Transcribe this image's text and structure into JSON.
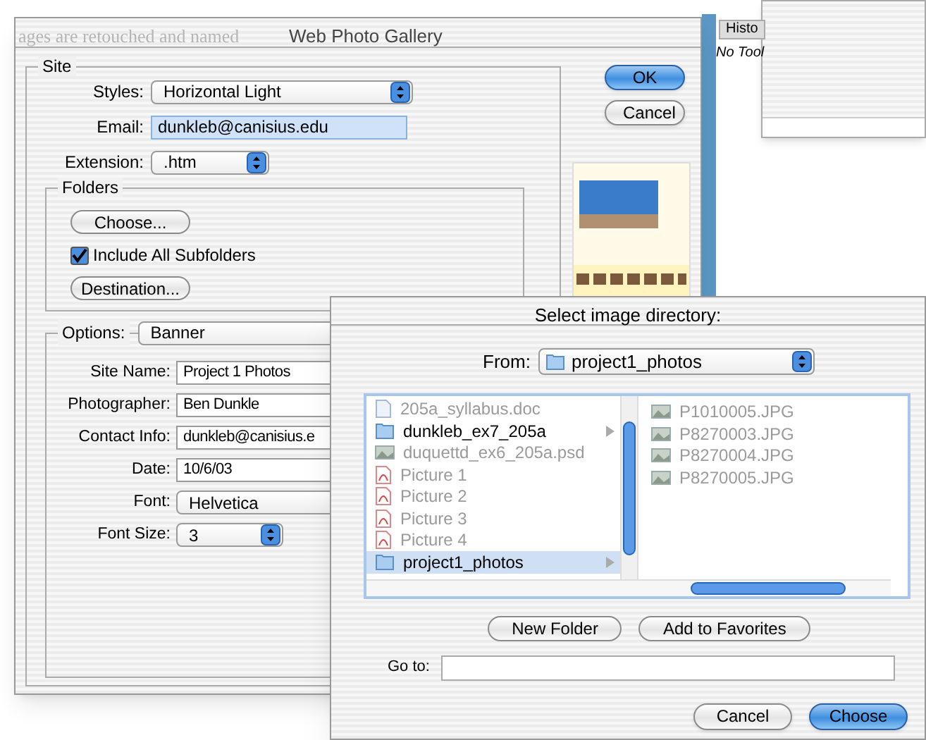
{
  "background": {
    "document_text": "ages are retouched and named",
    "history_tab": "Histo",
    "tool_text": "No Tool"
  },
  "dialog": {
    "title": "Web Photo Gallery",
    "site": {
      "legend": "Site",
      "styles": {
        "label": "Styles:",
        "value": "Horizontal Light"
      },
      "email": {
        "label": "Email:",
        "value": "dunkleb@canisius.edu",
        "focused": true
      },
      "extension": {
        "label": "Extension:",
        "value": ".htm"
      },
      "folders": {
        "legend": "Folders",
        "choose": "Choose...",
        "include_subfolders": {
          "label": "Include All Subfolders",
          "checked": true
        },
        "destination": "Destination..."
      },
      "options": {
        "label": "Options:",
        "value": "Banner",
        "fields": [
          {
            "kind": "text",
            "label": "Site Name:",
            "value": "Project 1 Photos"
          },
          {
            "kind": "text",
            "label": "Photographer:",
            "value": "Ben Dunkle"
          },
          {
            "kind": "text",
            "label": "Contact Info:",
            "value": "dunkleb@canisius.e"
          },
          {
            "kind": "text",
            "label": "Date:",
            "value": "10/6/03"
          },
          {
            "kind": "popup",
            "label": "Font:",
            "value": "Helvetica"
          },
          {
            "kind": "popup",
            "label": "Font Size:",
            "value": "3"
          }
        ]
      }
    },
    "buttons": [
      {
        "label": "OK",
        "default": true
      },
      {
        "label": "Cancel",
        "default": false
      }
    ]
  },
  "sheet": {
    "title": "Select image directory:",
    "from": {
      "label": "From:",
      "value": "project1_photos"
    },
    "left_column": [
      {
        "kind": "document",
        "name": "205a_syllabus.doc",
        "disabled": true,
        "selected": false
      },
      {
        "kind": "folder",
        "name": "dunkleb_ex7_205a",
        "disabled": false,
        "selected": false
      },
      {
        "kind": "image",
        "name": "duquettd_ex6_205a.psd",
        "disabled": true,
        "selected": false
      },
      {
        "kind": "pdf",
        "name": "Picture 1",
        "disabled": true,
        "selected": false
      },
      {
        "kind": "pdf",
        "name": "Picture 2",
        "disabled": true,
        "selected": false
      },
      {
        "kind": "pdf",
        "name": "Picture 3",
        "disabled": true,
        "selected": false
      },
      {
        "kind": "pdf",
        "name": "Picture 4",
        "disabled": true,
        "selected": false
      },
      {
        "kind": "folder",
        "name": "project1_photos",
        "disabled": false,
        "selected": true
      }
    ],
    "right_column": [
      {
        "kind": "image",
        "name": "P1010005.JPG",
        "disabled": true,
        "selected": false
      },
      {
        "kind": "image",
        "name": "P8270003.JPG",
        "disabled": true,
        "selected": false
      },
      {
        "kind": "image",
        "name": "P8270004.JPG",
        "disabled": true,
        "selected": false
      },
      {
        "kind": "image",
        "name": "P8270005.JPG",
        "disabled": true,
        "selected": false
      }
    ],
    "middle_buttons": [
      "New Folder",
      "Add to Favorites"
    ],
    "goto": {
      "label": "Go to:"
    },
    "buttons": [
      {
        "label": "Cancel",
        "default": false
      },
      {
        "label": "Choose",
        "default": true
      }
    ]
  }
}
